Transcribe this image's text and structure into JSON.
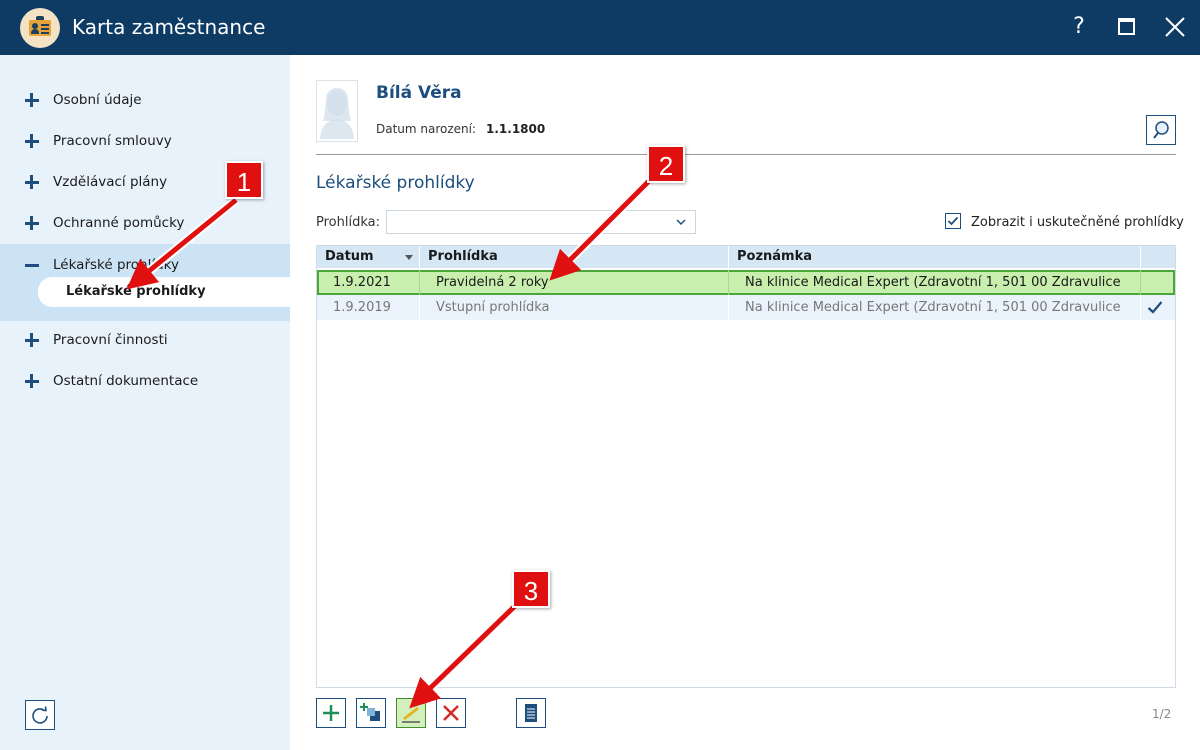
{
  "window": {
    "title": "Karta zaměstnance",
    "help_label": "?"
  },
  "sidebar": {
    "items": [
      {
        "label": "Osobní údaje",
        "state": "collapsed"
      },
      {
        "label": "Pracovní smlouvy",
        "state": "collapsed"
      },
      {
        "label": "Vzdělávací plány",
        "state": "collapsed"
      },
      {
        "label": "Ochranné pomůcky",
        "state": "collapsed"
      },
      {
        "label": "Lékařské prohlídky",
        "state": "expanded",
        "children": [
          {
            "label": "Lékařské prohlídky",
            "selected": true
          }
        ]
      },
      {
        "label": "Pracovní činnosti",
        "state": "collapsed"
      },
      {
        "label": "Ostatní dokumentace",
        "state": "collapsed"
      }
    ]
  },
  "employee": {
    "name": "Bílá Věra",
    "dob_label": "Datum narození:",
    "dob_value": "1.1.1800"
  },
  "section": {
    "title": "Lékařské prohlídky",
    "filter_label": "Prohlídka:",
    "filter_value": "",
    "show_done_label": "Zobrazit i uskutečněné prohlídky",
    "show_done_checked": true
  },
  "grid": {
    "columns": [
      "Datum",
      "Prohlídka",
      "Poznámka"
    ],
    "sort_column": "Datum",
    "rows": [
      {
        "date": "1.9.2021",
        "exam": "Pravidelná 2 roky",
        "note": "Na klinice Medical Expert (Zdravotní 1, 501 00 Zdravulice",
        "selected": true,
        "completed": false
      },
      {
        "date": "1.9.2019",
        "exam": "Vstupní prohlídka",
        "note": "Na klinice Medical Expert (Zdravotní 1, 501 00 Zdravulice",
        "selected": false,
        "completed": true
      }
    ]
  },
  "toolbar": {
    "buttons": [
      "add-icon",
      "copy-add-icon",
      "edit-icon",
      "delete-icon",
      "document-icon"
    ],
    "pager": "1/2"
  },
  "callouts": [
    "1",
    "2",
    "3"
  ],
  "colors": {
    "titlebar": "#0d3b63",
    "sidebar_bg": "#e8f2fb",
    "accent": "#1d4e7e",
    "selected_row": "#c8efad",
    "callout": "#e01010"
  }
}
